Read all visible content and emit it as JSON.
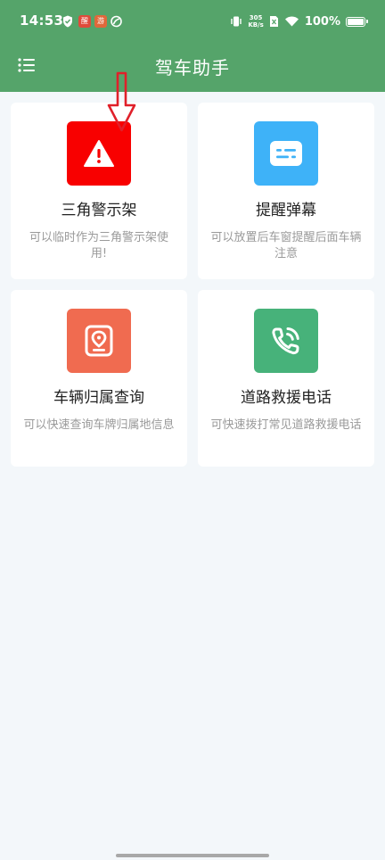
{
  "status_bar": {
    "time": "14:53",
    "net_speed_value": "305",
    "net_speed_unit": "KB/s",
    "battery": "100%",
    "notif_app1_text": "醒",
    "notif_app2_text": "游"
  },
  "app_bar": {
    "title": "驾车助手"
  },
  "cards": [
    {
      "title": "三角警示架",
      "description": "可以临时作为三角警示架使用!",
      "icon_color": "#f80000",
      "icon": "warning-triangle-icon"
    },
    {
      "title": "提醒弹幕",
      "description": "可以放置后车窗提醒后面车辆注意",
      "icon_color": "#3eb2f8",
      "icon": "message-icon"
    },
    {
      "title": "车辆归属查询",
      "description": "可以快速查询车牌归属地信息",
      "icon_color": "#f06b50",
      "icon": "location-card-icon"
    },
    {
      "title": "道路救援电话",
      "description": "可快速拨打常见道路救援电话",
      "icon_color": "#47b27a",
      "icon": "phone-call-icon"
    }
  ],
  "colors": {
    "primary_green": "#55a46a",
    "background": "#f3f7fa",
    "annotation_arrow": "#e0202a"
  }
}
